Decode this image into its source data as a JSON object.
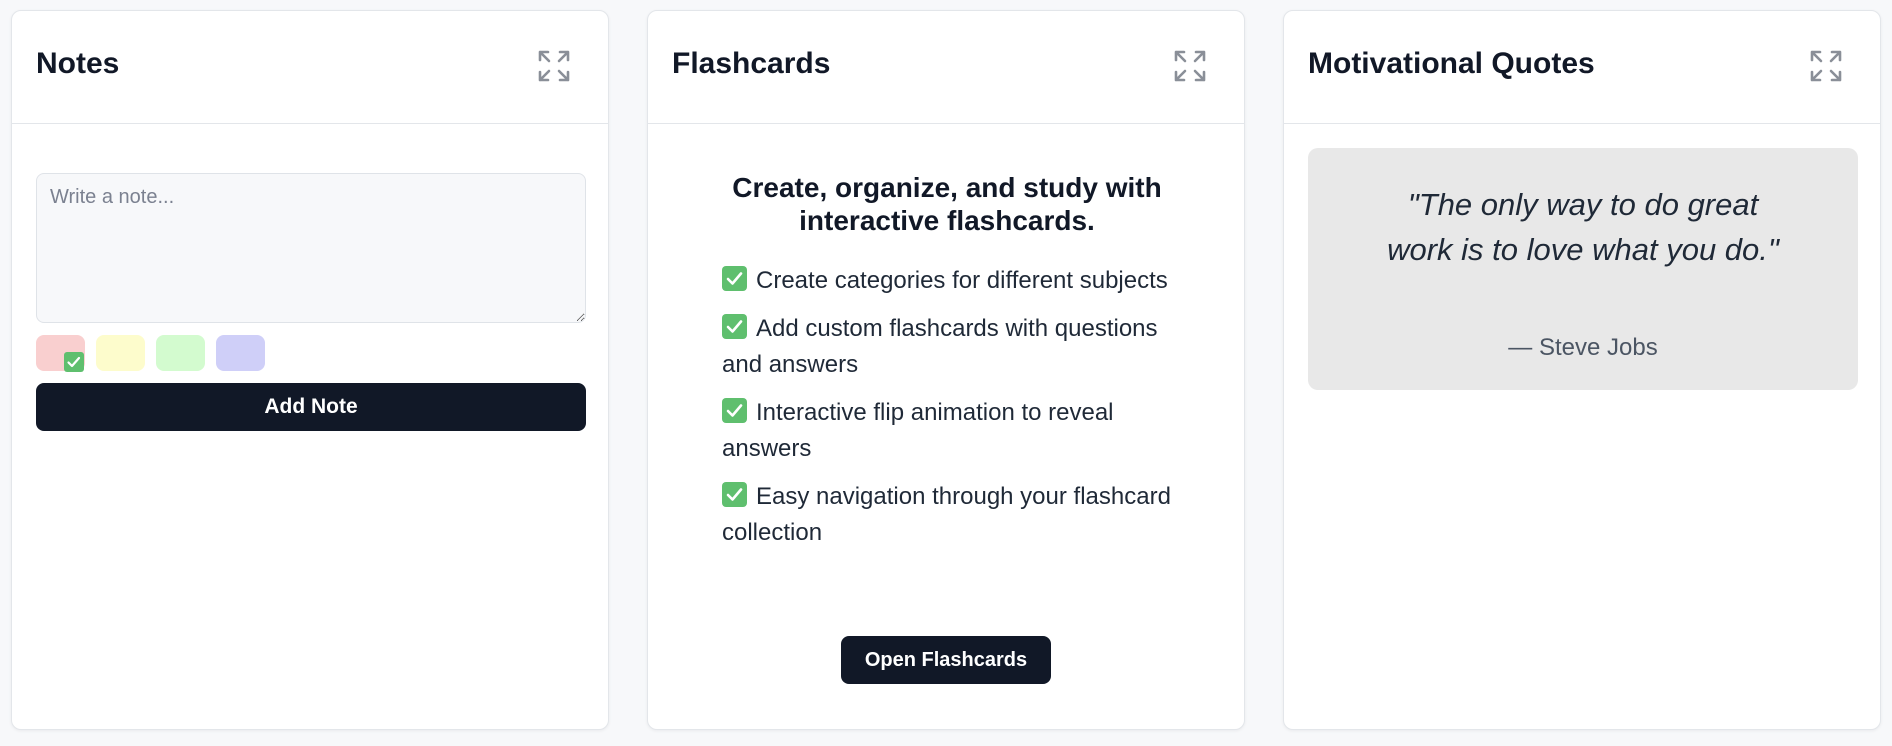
{
  "notes": {
    "title": "Notes",
    "input_placeholder": "Write a note...",
    "input_value": "",
    "colors": [
      {
        "name": "red",
        "hex": "#f9cfcf",
        "selected": true
      },
      {
        "name": "yellow",
        "hex": "#fdfccc",
        "selected": false
      },
      {
        "name": "green",
        "hex": "#d3fbcf",
        "selected": false
      },
      {
        "name": "blue",
        "hex": "#cfcff8",
        "selected": false
      }
    ],
    "add_label": "Add Note"
  },
  "flashcards": {
    "title": "Flashcards",
    "heading": "Create, organize, and study with interactive flashcards.",
    "features": [
      "Create categories for different subjects",
      "Add custom flashcards with questions and answers",
      "Interactive flip animation to reveal answers",
      "Easy navigation through your flashcard collection"
    ],
    "open_label": "Open Flashcards"
  },
  "quotes": {
    "title": "Motivational Quotes",
    "quote": "\"The only way to do great work is to love what you do.\"",
    "author": "— Steve Jobs"
  },
  "icons": {
    "expand": "expand-icon",
    "check": "check-box-icon"
  },
  "theme": {
    "accent_dark": "#111827",
    "check_green": "#5fbf6e",
    "page_bg": "#f7f8fa",
    "quote_bg": "#e8e8e8"
  }
}
